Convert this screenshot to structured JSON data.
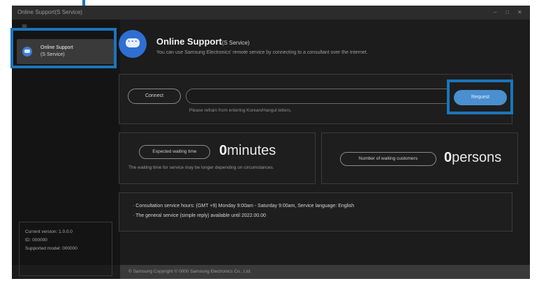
{
  "window": {
    "title": "Online Support(S Service)",
    "controls": [
      "–",
      "□",
      "✕"
    ]
  },
  "sidebar": {
    "menu_icon": "hamburger-icon",
    "item": {
      "icon": "chat-bubble-icon",
      "line1": "Online Support",
      "line2": "(S Service)"
    },
    "info": [
      "Current version: 1.0.0.0",
      "ID: 000000",
      "Supported model: 000000"
    ]
  },
  "header": {
    "icon": "chat-bubble-icon",
    "title": "Online Support",
    "title_suffix": "(S Service)",
    "description": "You can use Samsung Electronics' remote service by connecting to a consultant over the Internet."
  },
  "connect": {
    "connect_label": "Connect",
    "input_value": "",
    "input_hint": "Please refrain from entering Korean/Hangul letters.",
    "request_label": "Request"
  },
  "wait": {
    "pill_label": "Expected waiting time",
    "value": "0",
    "unit": "minutes",
    "note": "The waiting time for service may be longer depending on circumstances."
  },
  "persons": {
    "pill_label": "Number of waiting customers",
    "value": "0",
    "unit": "persons"
  },
  "notice": {
    "line1": "· Consultation service hours: (GMT +9) Monday 9:00am - Saturday 9:00am, Service language: English",
    "line2": "· The general service (simple reply) available until 2022.00.00"
  },
  "footer": {
    "copyright": "© Samsung Copyright © 0000 Samsung Electronics Co., Ltd."
  },
  "colors": {
    "callout": "#1b75bb",
    "accent": "#4a8fd0",
    "background": "#1c1c1c"
  }
}
